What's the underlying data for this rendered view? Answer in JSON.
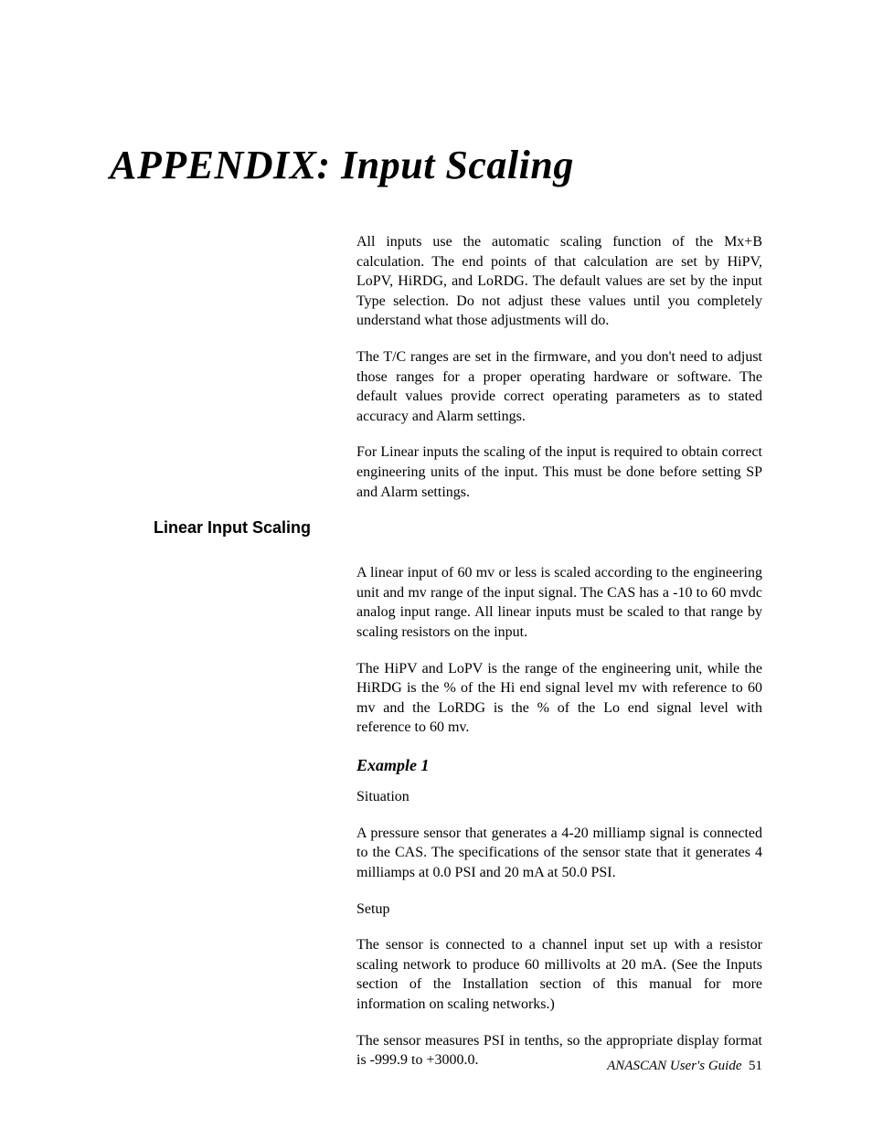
{
  "title": "APPENDIX: Input Scaling",
  "intro": {
    "p1": "All inputs use the automatic scaling function of the Mx+B calculation. The end points of that calculation are set by HiPV, LoPV, HiRDG, and LoRDG. The default values are set by the input Type selection. Do not adjust these values until you completely understand what those adjustments will do.",
    "p2": "The T/C ranges are set in the firmware, and you don't need to adjust those ranges for a proper operating hardware or software. The default values provide correct operating parameters as to stated accuracy and Alarm settings.",
    "p3": "For Linear inputs the scaling of the input is required to obtain correct engineering units of the input. This must be done before setting SP and Alarm settings."
  },
  "section": {
    "heading": "Linear Input Scaling",
    "p1": "A linear input of 60 mv or less is scaled according to the engineering unit and mv range of the input signal. The CAS has a -10 to 60 mvdc analog input range. All linear inputs must be scaled to that range by scaling resistors on the input.",
    "p2": "The HiPV and LoPV is the range of the engineering unit, while the HiRDG is the % of the Hi end signal level mv with reference to 60 mv and the LoRDG is the % of the Lo end signal level with reference to 60 mv."
  },
  "example": {
    "heading": "Example 1",
    "situation_label": "Situation",
    "situation_text": "A pressure sensor that generates a 4-20 milliamp signal is connected to the CAS. The specifications of the sensor state that it generates 4 milliamps at 0.0 PSI and 20 mA at 50.0 PSI.",
    "setup_label": "Setup",
    "setup_p1": "The sensor is connected to a channel input set up with a resistor scaling network to produce 60 millivolts at 20 mA. (See the Inputs section of the Installation section of this manual for more information on scaling networks.)",
    "setup_p2": "The sensor measures PSI in tenths, so the appropriate display format is -999.9 to +3000.0."
  },
  "footer": {
    "book": "ANASCAN User's Guide",
    "page": "51"
  }
}
